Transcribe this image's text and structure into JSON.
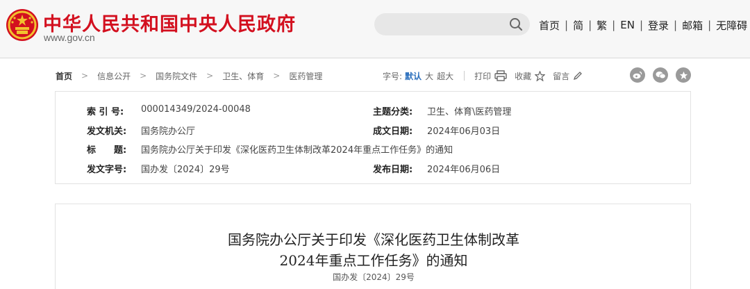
{
  "header": {
    "site_title": "中华人民共和国中央人民政府",
    "domain": "www.gov.cn",
    "search_placeholder": "",
    "nav": [
      "首页",
      "简",
      "繁",
      "EN",
      "登录",
      "邮箱",
      "无障碍"
    ],
    "separator": "|",
    "colors": {
      "title_red": "#d3101f",
      "emblem_gold": "#f2c12e"
    }
  },
  "breadcrumb": {
    "items": [
      "首页",
      "信息公开",
      "国务院文件",
      "卫生、体育",
      "医药管理"
    ],
    "arrow": ">"
  },
  "tools": {
    "font_label": "字号:",
    "font_default": "默认",
    "font_large": "大",
    "font_xlarge": "超大",
    "print": "打印",
    "favorite": "收藏",
    "comment": "留言"
  },
  "share_icons": [
    "weibo-icon",
    "wechat-icon",
    "star-icon"
  ],
  "meta": {
    "index_key": "索 引 号:",
    "index_val": "000014349/2024-00048",
    "category_key": "主题分类:",
    "category_val": "卫生、体育\\医药管理",
    "issuer_key": "发文机关:",
    "issuer_val": "国务院办公厅",
    "written_key": "成文日期:",
    "written_val": "2024年06月03日",
    "title_key": "标　　题:",
    "title_val": "国务院办公厅关于印发《深化医药卫生体制改革2024年重点工作任务》的通知",
    "docno_key": "发文字号:",
    "docno_val": "国办发〔2024〕29号",
    "published_key": "发布日期:",
    "published_val": "2024年06月06日"
  },
  "article": {
    "title_line1": "国务院办公厅关于印发《深化医药卫生体制改革",
    "title_line2": "2024年重点工作任务》的通知",
    "doc_number": "国办发〔2024〕29号"
  }
}
